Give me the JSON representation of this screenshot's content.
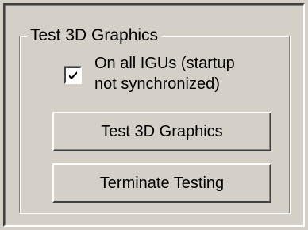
{
  "group": {
    "title": "Test 3D Graphics"
  },
  "checkbox": {
    "checked": true,
    "label_line1": "On all IGUs (startup",
    "label_line2": "not synchronized)"
  },
  "buttons": {
    "test_label": "Test 3D Graphics",
    "terminate_label": "Terminate Testing"
  },
  "colors": {
    "face": "#d4d0c8",
    "shadow": "#808080",
    "dark_shadow": "#404040",
    "highlight": "#ffffff"
  },
  "icons": {
    "check": "checkmark-icon"
  }
}
